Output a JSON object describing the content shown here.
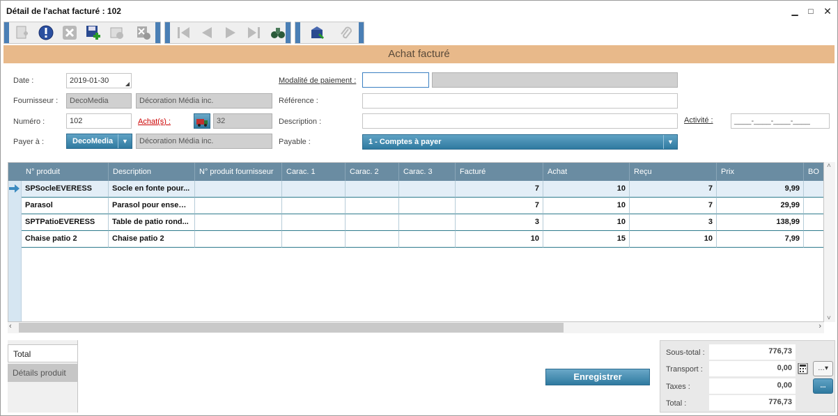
{
  "window": {
    "title": "Détail de l'achat facturé : 102"
  },
  "banner": {
    "title": "Achat facturé"
  },
  "form": {
    "date_label": "Date :",
    "date_value": "2019-01-30",
    "fournisseur_label": "Fournisseur :",
    "fournisseur_code": "DecoMedia",
    "fournisseur_name": "Décoration Média inc.",
    "numero_label": "Numéro :",
    "numero_value": "102",
    "achats_label": "Achat(s) :",
    "achats_value": "32",
    "payer_label": "Payer à :",
    "payer_code": "DecoMedia",
    "payer_name": "Décoration Média inc.",
    "modalite_label": "Modalité de paiement :",
    "modalite_value": "",
    "modalite_desc": "",
    "reference_label": "Référence :",
    "reference_value": "",
    "description_label": "Description :",
    "description_value": "",
    "activite_label": "Activité :",
    "activite_value": "____-____-____-____",
    "payable_label": "Payable :",
    "payable_value": "1 - Comptes à payer"
  },
  "grid": {
    "columns": [
      "N° produit",
      "Description",
      "N° produit fournisseur",
      "Carac. 1",
      "Carac. 2",
      "Carac. 3",
      "Facturé",
      "Achat",
      "Reçu",
      "Prix",
      "BO"
    ],
    "rows": [
      [
        "SPSocleEVERESS",
        "Socle en fonte pour...",
        "",
        "",
        "",
        "",
        "7",
        "10",
        "7",
        "9,99",
        ""
      ],
      [
        "Parasol",
        "Parasol pour ensem...",
        "",
        "",
        "",
        "",
        "7",
        "10",
        "7",
        "29,99",
        ""
      ],
      [
        "SPTPatioEVERESS",
        "Table de patio rond...",
        "",
        "",
        "",
        "",
        "3",
        "10",
        "3",
        "138,99",
        ""
      ],
      [
        "Chaise patio 2",
        "Chaise patio 2",
        "",
        "",
        "",
        "",
        "10",
        "15",
        "10",
        "7,99",
        ""
      ]
    ]
  },
  "tabs": {
    "total": "Total",
    "details": "Détails produit"
  },
  "save_button": "Enregistrer",
  "totals": {
    "soustotal_label": "Sous-total :",
    "soustotal_value": "776,73",
    "transport_label": "Transport :",
    "transport_value": "0,00",
    "taxes_label": "Taxes :",
    "taxes_value": "0,00",
    "total_label": "Total :",
    "total_value": "776,73",
    "more_button": "..."
  },
  "colors": {
    "accent": "#2f7aa0",
    "banner": "#e8b98a",
    "grid_header": "#6a8ca2",
    "toolbar_grip": "#4a7fb5"
  }
}
